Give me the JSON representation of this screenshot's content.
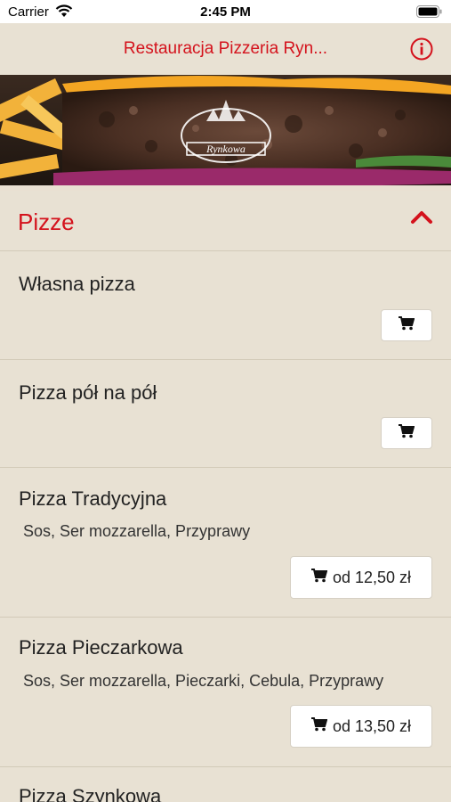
{
  "status": {
    "carrier": "Carrier",
    "time": "2:45 PM"
  },
  "nav": {
    "title": "Restauracja Pizzeria Ryn..."
  },
  "banner": {
    "logo_text": "Rynkowa"
  },
  "category": {
    "title": "Pizze"
  },
  "items": [
    {
      "name": "Własna pizza",
      "description": "",
      "price": ""
    },
    {
      "name": "Pizza pół na pół",
      "description": "",
      "price": ""
    },
    {
      "name": "Pizza Tradycyjna",
      "description": "Sos, Ser mozzarella, Przyprawy",
      "price": "od 12,50 zł"
    },
    {
      "name": "Pizza Pieczarkowa",
      "description": "Sos, Ser mozzarella, Pieczarki, Cebula, Przyprawy",
      "price": "od 13,50 zł"
    },
    {
      "name": "Pizza Szynkowa",
      "description": "",
      "price": ""
    }
  ],
  "colors": {
    "accent": "#d4121c",
    "background": "#e8e1d3"
  }
}
